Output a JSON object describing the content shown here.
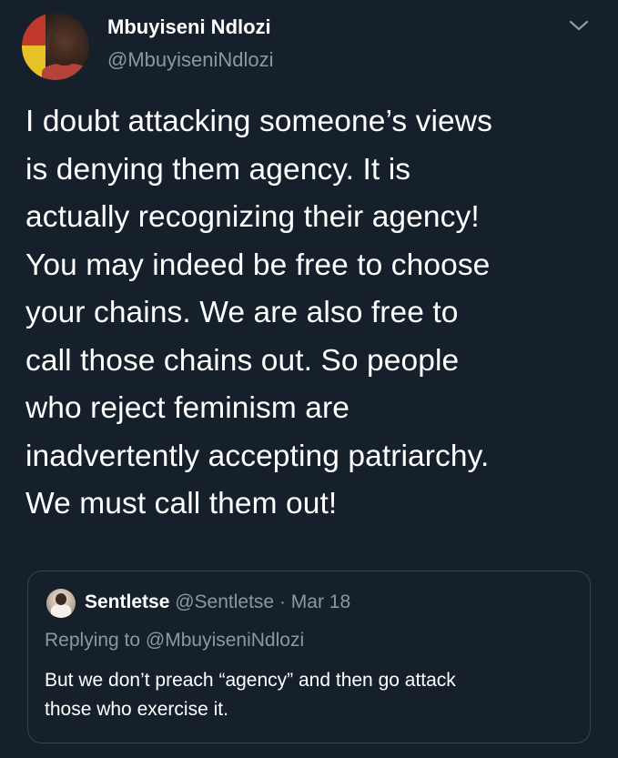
{
  "tweet": {
    "author_name": "Mbuyiseni Ndlozi",
    "author_handle": "@MbuyiseniNdlozi",
    "avatar_icon": "profile-photo",
    "menu_icon": "chevron-down-icon",
    "text": "I doubt attacking someone’s views\nis denying them agency. It is\nactually recognizing their agency!\nYou may indeed be free to choose\nyour chains. We are also free to\ncall those chains out. So people\nwho reject feminism are\ninadvertently accepting patriarchy.\nWe must call them out!"
  },
  "quoted_tweet": {
    "author_name": "Sentletse",
    "author_handle": "@Sentletse",
    "separator": "·",
    "date": "Mar 18",
    "replying_to": "Replying to @MbuyiseniNdlozi",
    "text": "But we don’t preach “agency” and then go attack\nthose who exercise it."
  },
  "colors": {
    "background": "#15202b",
    "text_primary": "#ffffff",
    "text_secondary": "#8899a6",
    "border": "#38444d"
  }
}
